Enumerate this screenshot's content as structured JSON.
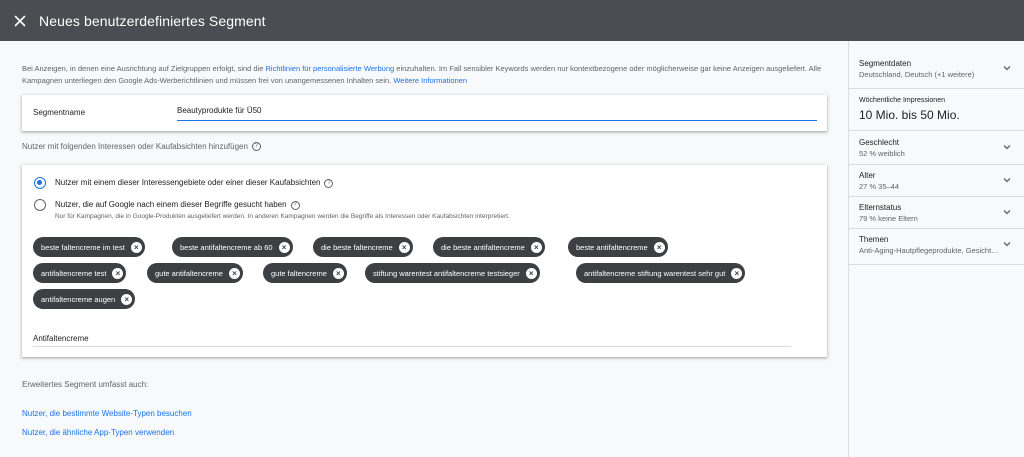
{
  "header": {
    "title": "Neues benutzerdefiniertes Segment"
  },
  "notice": {
    "part1": "Bei Anzeigen, in denen eine Ausrichtung auf Zielgruppen erfolgt, sind die ",
    "link1": "Richtlinien für personalisierte Werbung",
    "part2": " einzuhalten. Im Fall sensibler Keywords werden nur kontextbezogene oder möglicherweise gar keine Anzeigen ausgeliefert. Alle Kampagnen unterliegen den Google Ads-Werberichtlinien und müssen frei von unangemessenen Inhalten sein. ",
    "link2": "Weitere Informationen"
  },
  "segment_name": {
    "label": "Segmentname",
    "value": "Beautyprodukte für Ü50"
  },
  "interests_section": {
    "label": "Nutzer mit folgenden Interessen oder Kaufabsichten hinzufügen",
    "option1": "Nutzer mit einem dieser Interessengebiete oder einer dieser Kaufabsichten",
    "option2": "Nutzer, die auf Google nach einem dieser Begriffe gesucht haben",
    "option2_sub": "Nur für Kampagnen, die in Google-Produkten ausgeliefert werden. In anderen Kampagnen werden die Begriffe als Interessen oder Kaufabsichten interpretiert.",
    "chips": [
      "beste faltencreme im test",
      "beste antifaltencreme ab 60",
      "die beste faltencreme",
      "die beste antifaltencreme",
      "beste antifaltencreme",
      "antifaltencreme test",
      "gute antifaltencreme",
      "gute faltencreme",
      "stiftung warentest antifaltencreme testsieger",
      "antifaltencreme stiftung warentest sehr gut",
      "antifaltencreme augen"
    ],
    "input_value": "Antifaltencreme"
  },
  "extended": {
    "label": "Erweitertes Segment umfasst auch:",
    "link1": "Nutzer, die bestimmte Website-Typen besuchen",
    "link2": "Nutzer, die ähnliche App-Typen verwenden"
  },
  "right_panel": {
    "segmentdaten_title": "Segmentdaten",
    "segmentdaten_value": "Deutschland, Deutsch (+1 weitere)",
    "impressions_title": "Wöchentliche Impressionen",
    "impressions_value": "10 Mio. bis 50 Mio.",
    "geschlecht_title": "Geschlecht",
    "geschlecht_value": "52 % weiblich",
    "alter_title": "Alter",
    "alter_value": "27 % 35–44",
    "elternstatus_title": "Elternstatus",
    "elternstatus_value": "79 % keine Eltern",
    "themen_title": "Themen",
    "themen_value": "Anti-Aging-Hautpflegeprodukte, Gesichtspflege"
  },
  "colors": {
    "topbar": "#4a4d52",
    "accent": "#1a73e8",
    "chip": "#3c4043"
  }
}
